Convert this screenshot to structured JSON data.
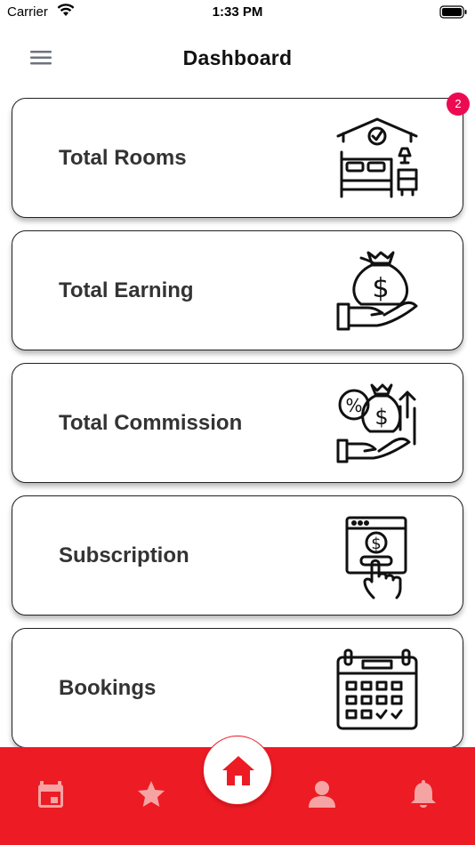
{
  "status_bar": {
    "carrier": "Carrier",
    "time": "1:33 PM"
  },
  "header": {
    "title": "Dashboard",
    "menu_icon": "hamburger-menu-icon"
  },
  "cards": [
    {
      "label": "Total Rooms",
      "icon": "bedroom-icon"
    },
    {
      "label": "Total Earning",
      "icon": "money-bag-hand-icon"
    },
    {
      "label": "Total Commission",
      "icon": "commission-icon"
    },
    {
      "label": "Subscription",
      "icon": "subscription-click-icon"
    },
    {
      "label": "Bookings",
      "icon": "calendar-icon"
    }
  ],
  "notification_badge": "2",
  "bottom_nav": {
    "items": [
      "calendar-icon",
      "star-icon",
      "home-icon",
      "profile-icon",
      "bell-icon"
    ],
    "active": "home-icon"
  },
  "colors": {
    "nav_background": "#ed1b24",
    "badge": "#ec0b52",
    "nav_icon": "#f6a3a3"
  }
}
